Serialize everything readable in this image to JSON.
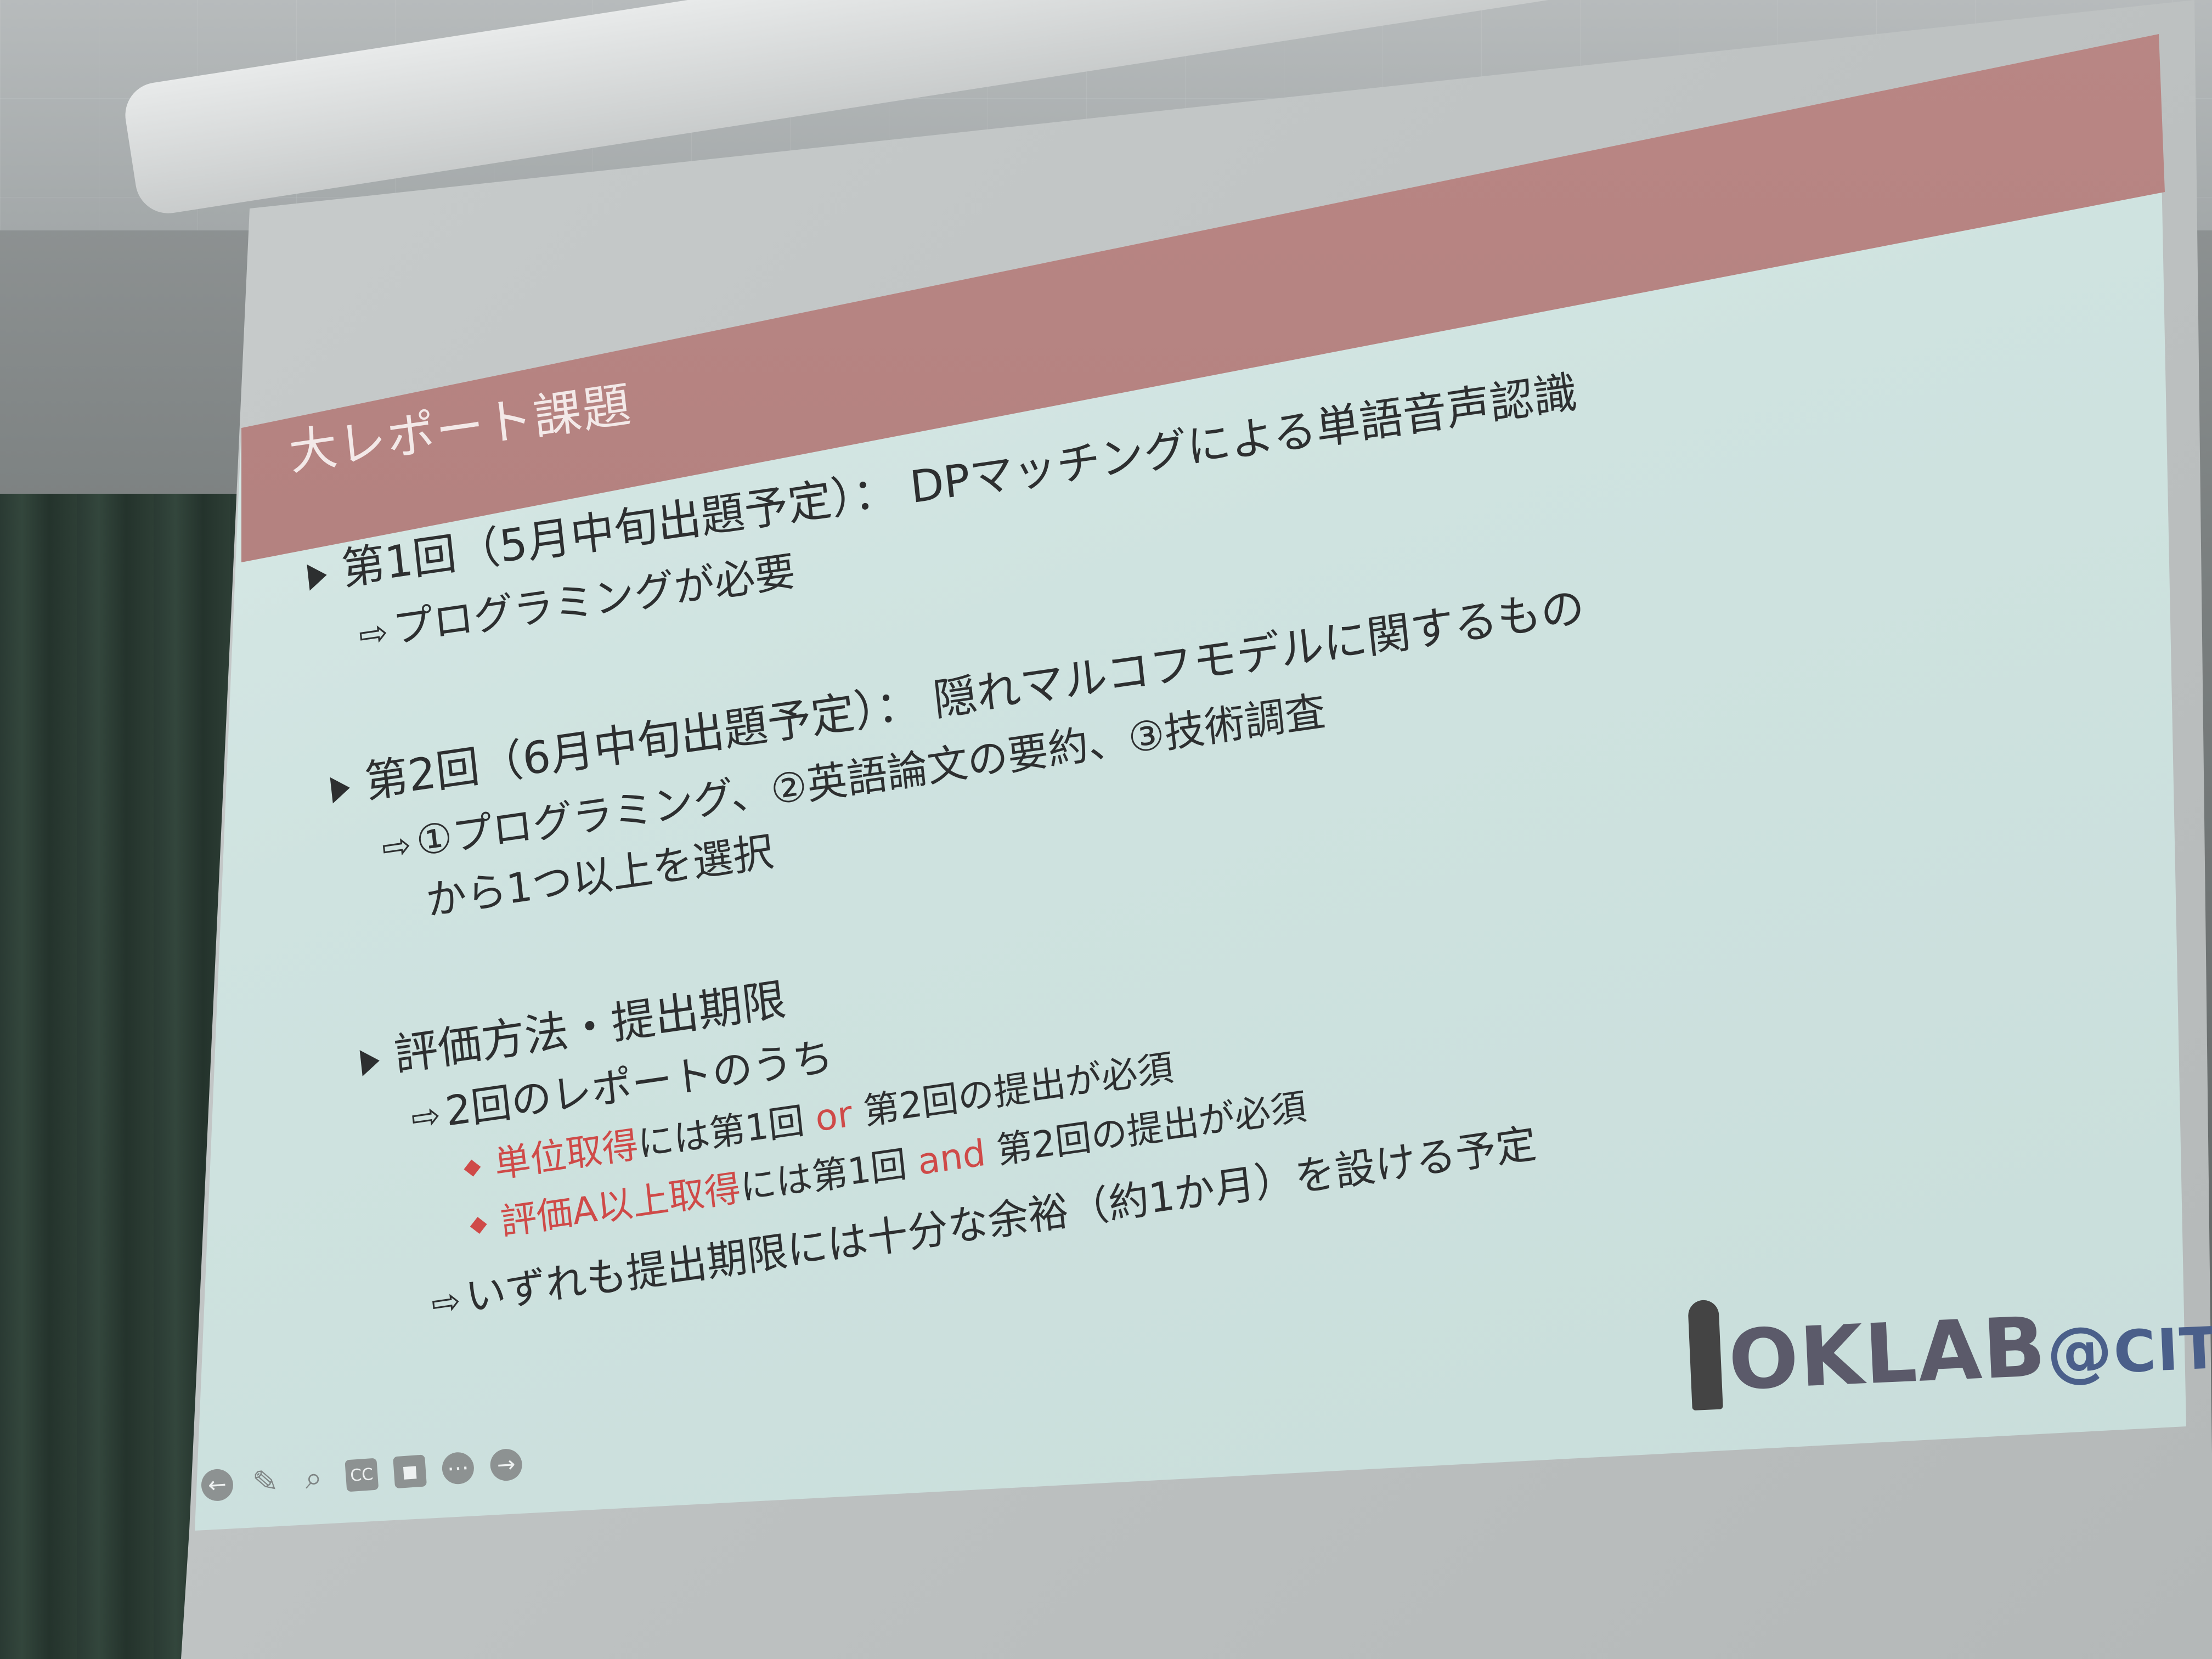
{
  "slide": {
    "title": "大レポート課題",
    "section1": {
      "heading": "第1回（5月中旬出題予定）： DPマッチングによる単語音声認識",
      "sub": "プログラミングが必要"
    },
    "section2": {
      "heading": "第2回（6月中旬出題予定）： 隠れマルコフモデルに関するもの",
      "sub1": "①プログラミング、②英語論文の要約、③技術調査",
      "sub2": "から1つ以上を選択"
    },
    "section3": {
      "heading": "評価方法・提出期限",
      "sub": "2回のレポートのうち",
      "bullet1_red": "単位取得",
      "bullet1_a": "には第1回 ",
      "bullet1_or": "or",
      "bullet1_b": " 第2回の提出が必須",
      "bullet2_red": "評価A以上取得",
      "bullet2_a": "には第1回 ",
      "bullet2_and": "and",
      "bullet2_b": " 第2回の提出が必須",
      "note": "いずれも提出期限には十分な余裕（約1か月）を設ける予定"
    },
    "logo": {
      "main": "OKLAB",
      "at": "@",
      "suffix": "CIT"
    }
  },
  "controls": [
    {
      "icon": "arrow-left-icon",
      "glyph": "←"
    },
    {
      "icon": "pen-icon",
      "glyph": "✎"
    },
    {
      "icon": "search-icon",
      "glyph": "⌕"
    },
    {
      "icon": "captions-icon",
      "glyph": "CC"
    },
    {
      "icon": "camera-icon",
      "glyph": "■"
    },
    {
      "icon": "more-icon",
      "glyph": "⋯"
    },
    {
      "icon": "arrow-right-icon",
      "glyph": "→"
    }
  ]
}
